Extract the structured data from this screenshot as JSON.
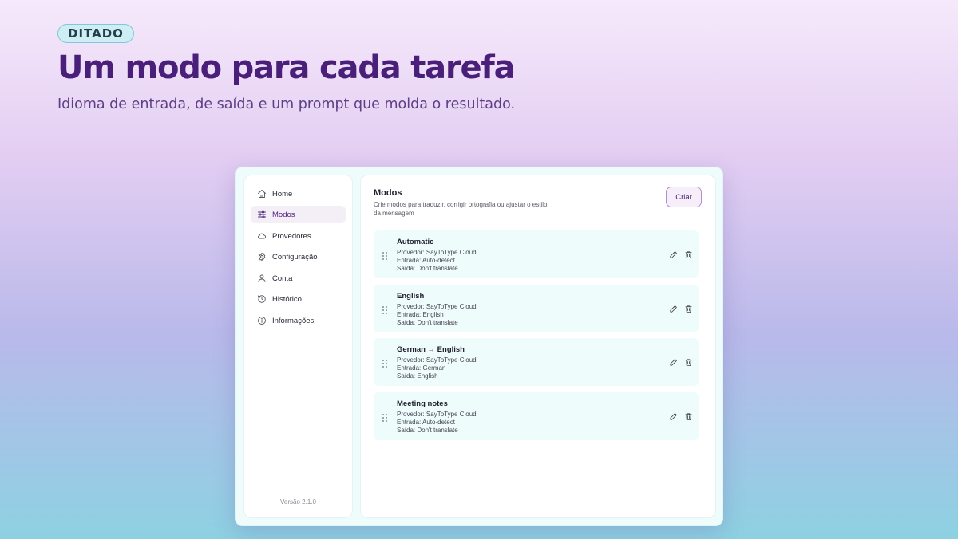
{
  "hero": {
    "badge": "DITADO",
    "title": "Um modo para cada tarefa",
    "subtitle": "Idioma de entrada, de saída e um prompt que molda o resultado."
  },
  "sidebar": {
    "items": [
      {
        "label": "Home",
        "icon": "home-icon"
      },
      {
        "label": "Modos",
        "icon": "sliders-icon",
        "active": true
      },
      {
        "label": "Provedores",
        "icon": "cloud-icon"
      },
      {
        "label": "Configuração",
        "icon": "gear-icon"
      },
      {
        "label": "Conta",
        "icon": "user-icon"
      },
      {
        "label": "Histórico",
        "icon": "history-icon"
      },
      {
        "label": "Informações",
        "icon": "info-icon"
      }
    ],
    "version": "Versão 2.1.0"
  },
  "main": {
    "title": "Modos",
    "description": "Crie modos para traduzir, corrigir ortografia ou ajustar o estilo da mensagem",
    "create_label": "Criar",
    "modes": [
      {
        "name": "Automatic",
        "provider": "Provedor: SayToType Cloud",
        "input": "Entrada: Auto-detect",
        "output": "Saída: Don't translate"
      },
      {
        "name": "English",
        "provider": "Provedor: SayToType Cloud",
        "input": "Entrada: English",
        "output": "Saída: Don't translate"
      },
      {
        "name": "German → English",
        "provider": "Provedor: SayToType Cloud",
        "input": "Entrada: German",
        "output": "Saída: English"
      },
      {
        "name": "Meeting notes",
        "provider": "Provedor: SayToType Cloud",
        "input": "Entrada: Auto-detect",
        "output": "Saída: Don't translate"
      }
    ]
  },
  "colors": {
    "accent": "#4a1f7a",
    "card_background": "#effcfc",
    "badge_background": "#cfeef3"
  }
}
